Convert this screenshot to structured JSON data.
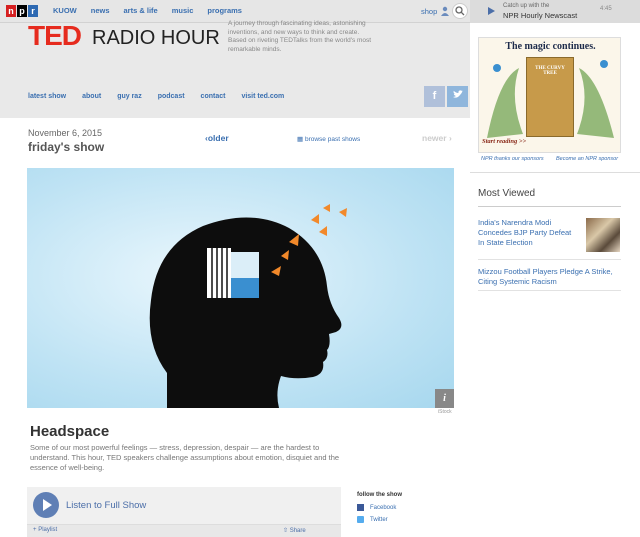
{
  "topbar": {
    "nav": [
      "KUOW",
      "news",
      "arts & life",
      "music",
      "programs"
    ],
    "shop": "shop",
    "player": {
      "catch": "Catch up with the",
      "title": "NPR Hourly Newscast",
      "duration": "4:45"
    }
  },
  "header": {
    "ted": "TED",
    "radio_hour": "RADIO HOUR",
    "tagline": "A journey through fascinating ideas, astonishing inventions, and new ways to think and create. Based on riveting TEDTalks from the world's most remarkable minds.",
    "subnav": [
      "latest show",
      "about",
      "guy raz",
      "podcast",
      "contact",
      "visit ted.com"
    ]
  },
  "show": {
    "date": "November 6, 2015",
    "title": "friday's show",
    "older": "older",
    "browse": "browse past shows",
    "newer": "newer",
    "credit": "iStock",
    "headline": "Headspace",
    "teaser": "Some of our most powerful feelings — stress, depression, despair — are the hardest to understand. This hour, TED speakers challenge assumptions about emotion, disquiet and the essence of well-being.",
    "listen": "Listen to Full Show",
    "playlist": "Playlist",
    "share": "Share"
  },
  "follow": {
    "title": "follow the show",
    "facebook": "Facebook",
    "twitter": "Twitter"
  },
  "sidebar": {
    "ad_title": "The magic continues.",
    "ad_book": "THE CURVY TREE",
    "ad_start": "Start reading >>",
    "thanks": "NPR thanks our sponsors",
    "become": "Become an NPR sponsor",
    "most_viewed": "Most Viewed",
    "stories": [
      "India's Narendra Modi Concedes BJP Party Defeat In State Election",
      "Mizzou Football Players Pledge A Strike, Citing Systemic Racism"
    ]
  }
}
